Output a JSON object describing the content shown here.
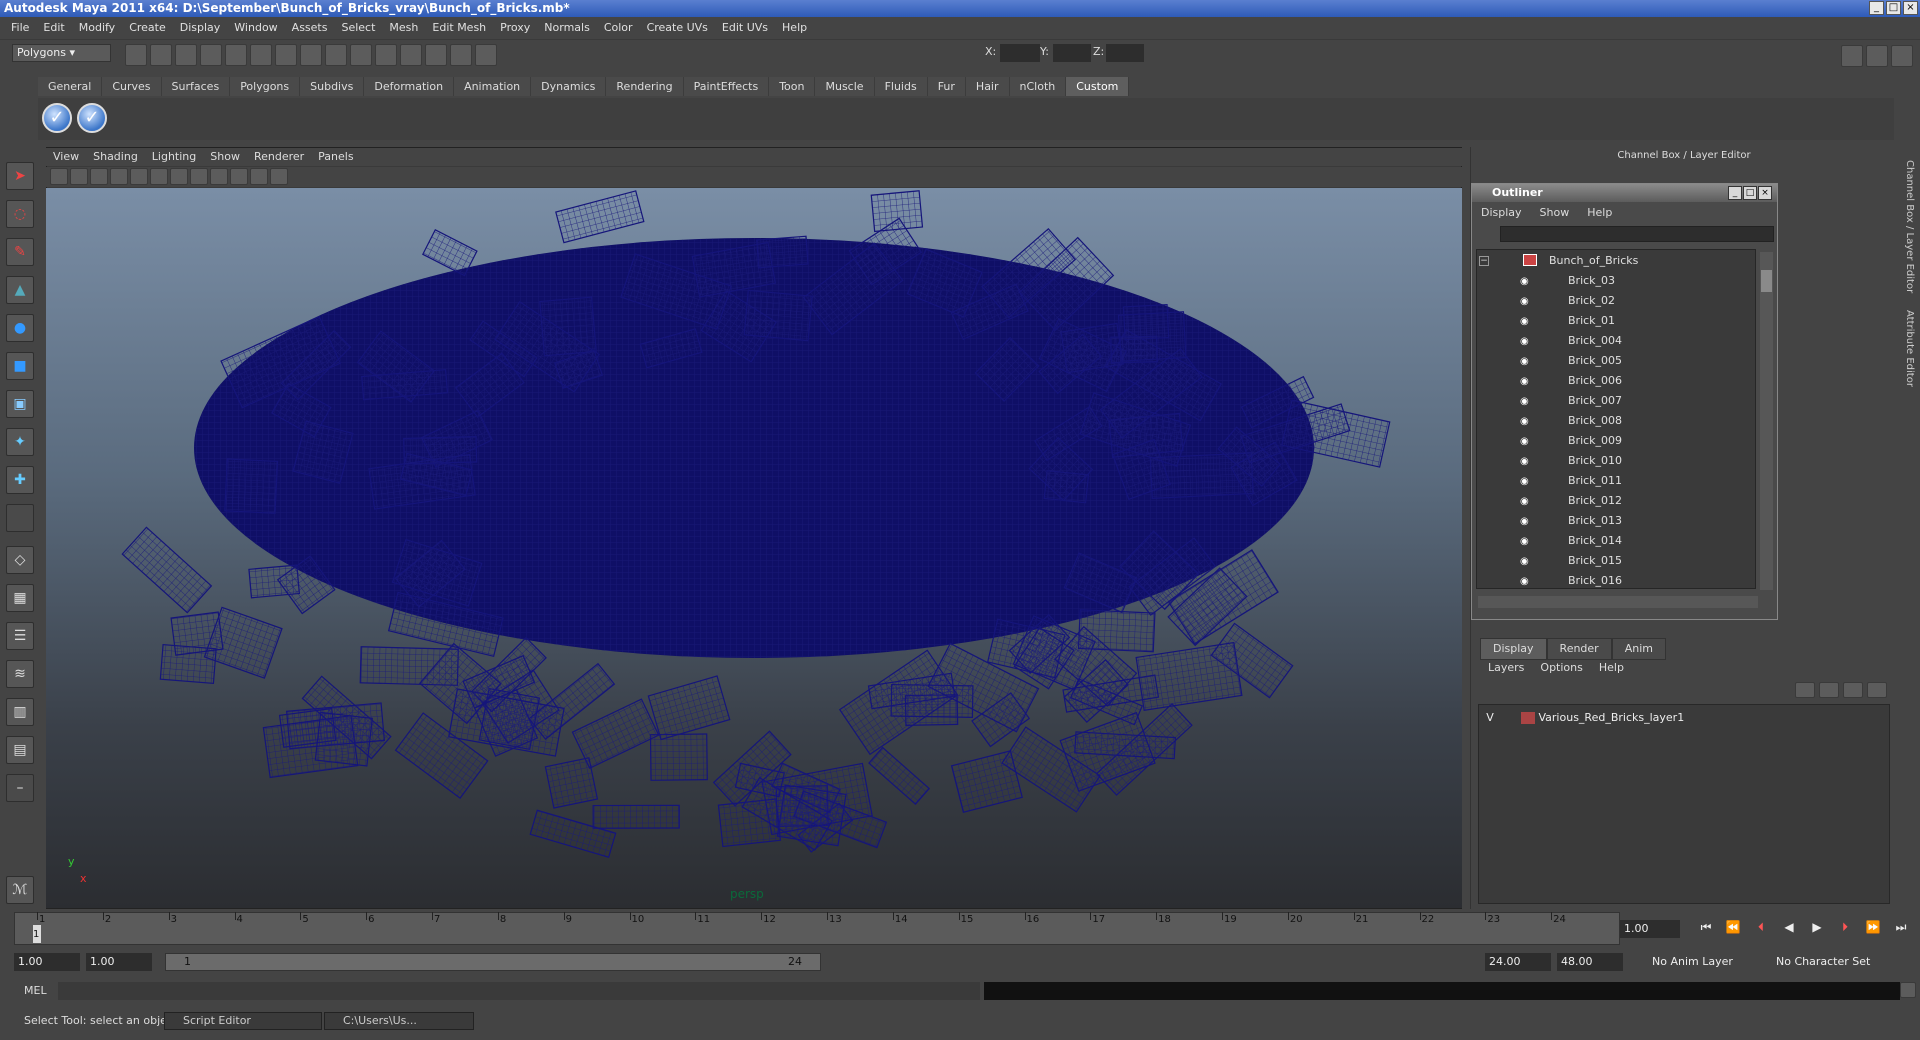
{
  "window": {
    "title": "Autodesk Maya 2011 x64: D:\\September\\Bunch_of_Bricks_vray\\Bunch_of_Bricks.mb*"
  },
  "menubar": [
    "File",
    "Edit",
    "Modify",
    "Create",
    "Display",
    "Window",
    "Assets",
    "Select",
    "Mesh",
    "Edit Mesh",
    "Proxy",
    "Normals",
    "Color",
    "Create UVs",
    "Edit UVs",
    "Help"
  ],
  "statusline": {
    "mode": "Polygons",
    "x_label": "X:",
    "y_label": "Y:",
    "z_label": "Z:"
  },
  "shelf": {
    "tabs": [
      "General",
      "Curves",
      "Surfaces",
      "Polygons",
      "Subdivs",
      "Deformation",
      "Animation",
      "Dynamics",
      "Rendering",
      "PaintEffects",
      "Toon",
      "Muscle",
      "Fluids",
      "Fur",
      "Hair",
      "nCloth",
      "Custom"
    ],
    "active": "Custom"
  },
  "viewport": {
    "menu": [
      "View",
      "Shading",
      "Lighting",
      "Show",
      "Renderer",
      "Panels"
    ],
    "camera": "persp",
    "axis_y": "y",
    "axis_x": "x"
  },
  "rightpanel": {
    "title": "Channel Box / Layer Editor",
    "side_tab_1": "Channel Box / Layer Editor",
    "side_tab_2": "Attribute Editor"
  },
  "outliner": {
    "title": "Outliner",
    "menu": [
      "Display",
      "Show",
      "Help"
    ],
    "root": "Bunch_of_Bricks",
    "items": [
      "Brick_03",
      "Brick_02",
      "Brick_01",
      "Brick_004",
      "Brick_005",
      "Brick_006",
      "Brick_007",
      "Brick_008",
      "Brick_009",
      "Brick_010",
      "Brick_011",
      "Brick_012",
      "Brick_013",
      "Brick_014",
      "Brick_015",
      "Brick_016"
    ]
  },
  "layers": {
    "tabs": [
      "Display",
      "Render",
      "Anim"
    ],
    "menu": [
      "Layers",
      "Options",
      "Help"
    ],
    "layer": {
      "visible": "V",
      "name": "Various_Red_Bricks_layer1"
    }
  },
  "timeline": {
    "ticks": [
      "1",
      "2",
      "3",
      "4",
      "5",
      "6",
      "7",
      "8",
      "9",
      "10",
      "11",
      "12",
      "13",
      "14",
      "15",
      "16",
      "17",
      "18",
      "19",
      "20",
      "21",
      "22",
      "23",
      "24"
    ],
    "current_marker": "1",
    "current_frame": "1.00"
  },
  "range": {
    "start": "1.00",
    "playback_start": "1.00",
    "slider_start": "1",
    "slider_end": "24",
    "playback_end": "24.00",
    "end": "48.00",
    "anim_layer": "No Anim Layer",
    "char_set": "No Character Set"
  },
  "commandline": {
    "label": "MEL"
  },
  "helpline": {
    "text": "Select Tool: select an object",
    "task1": "Script Editor",
    "task2": "C:\\Users\\Us..."
  }
}
